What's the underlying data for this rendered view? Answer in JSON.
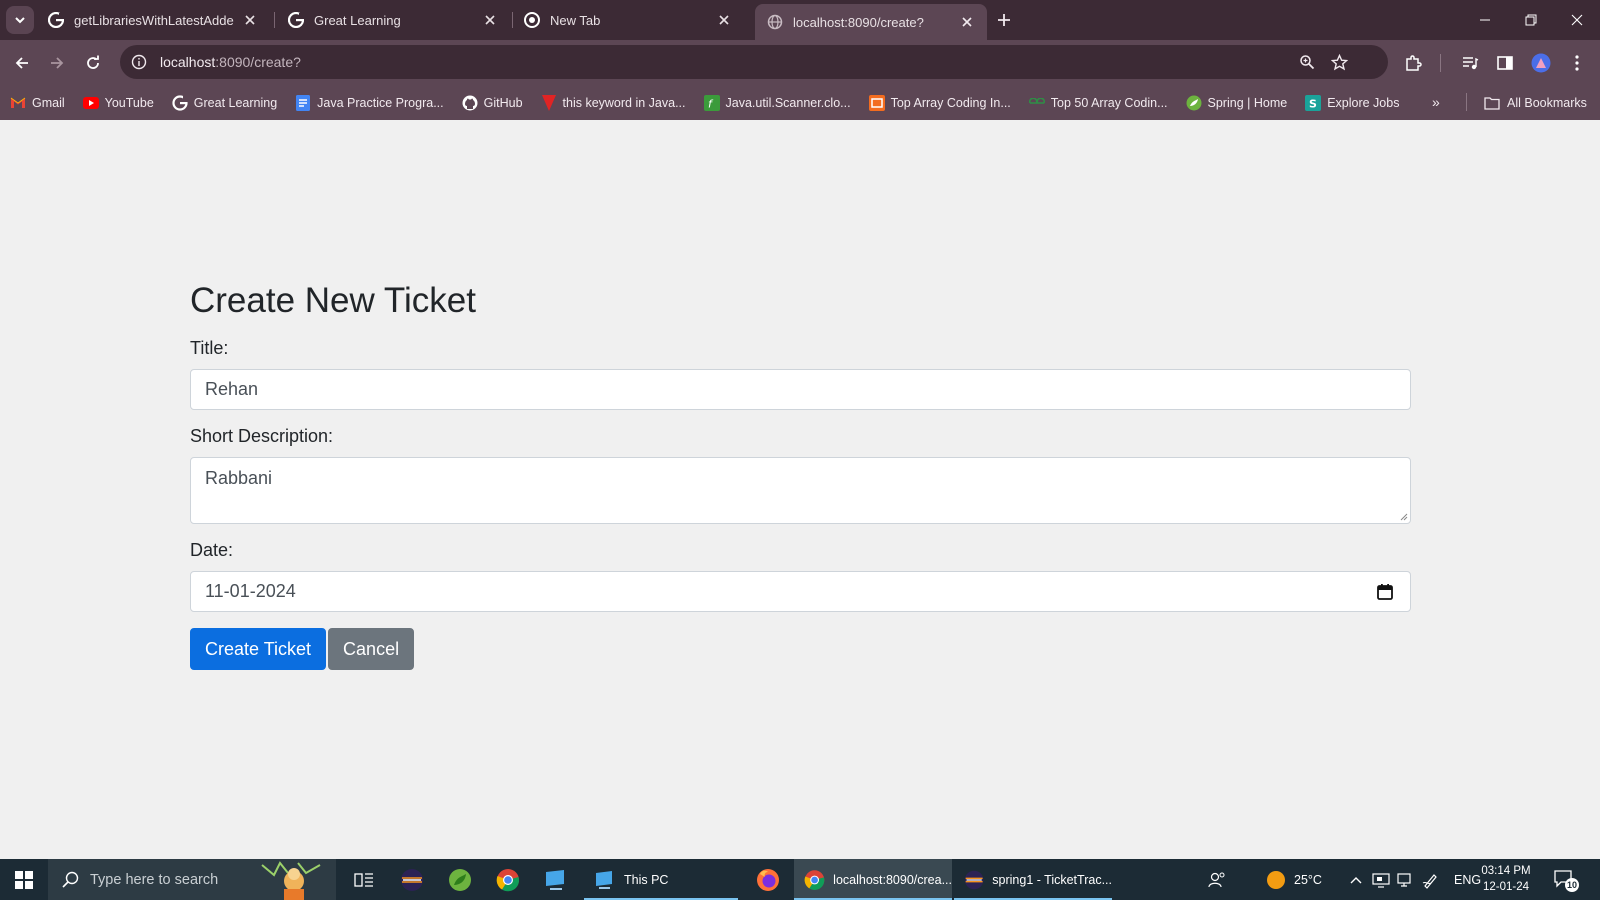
{
  "browser": {
    "tabs": [
      {
        "title": "getLibrariesWithLatestAddedOr",
        "icon": "google-g-icon",
        "active": false
      },
      {
        "title": "Great Learning",
        "icon": "google-g-icon",
        "active": false
      },
      {
        "title": "New Tab",
        "icon": "chrome-icon",
        "active": false
      },
      {
        "title": "localhost:8090/create?",
        "icon": "globe-icon",
        "active": true
      }
    ],
    "address": {
      "host": "localhost",
      "path": ":8090/create?"
    },
    "bookmarks": [
      {
        "label": "Gmail",
        "icon": "gmail-icon"
      },
      {
        "label": "YouTube",
        "icon": "youtube-icon"
      },
      {
        "label": "Great Learning",
        "icon": "google-g-icon"
      },
      {
        "label": "Java Practice Progra...",
        "icon": "docs-icon"
      },
      {
        "label": "GitHub",
        "icon": "github-icon"
      },
      {
        "label": "this keyword in Java...",
        "icon": "bookmark-red-icon"
      },
      {
        "label": "Java.util.Scanner.clo...",
        "icon": "scanner-site-icon"
      },
      {
        "label": "Top Array Coding In...",
        "icon": "coding-site-icon"
      },
      {
        "label": "Top 50 Array Codin...",
        "icon": "gfg-icon"
      },
      {
        "label": "Spring | Home",
        "icon": "spring-icon"
      },
      {
        "label": "Explore Jobs",
        "icon": "jobs-site-icon"
      }
    ],
    "all_bookmarks_label": "All Bookmarks",
    "more_bookmarks_label": "»"
  },
  "form": {
    "heading": "Create New Ticket",
    "title_label": "Title:",
    "title_value": "Rehan",
    "description_label": "Short Description:",
    "description_value": "Rabbani",
    "date_label": "Date:",
    "date_value": "11-01-2024",
    "submit_label": "Create Ticket",
    "cancel_label": "Cancel"
  },
  "taskbar": {
    "search_placeholder": "Type here to search",
    "apps": [
      {
        "label": "",
        "icon": "task-view-icon"
      },
      {
        "label": "",
        "icon": "eclipse-icon"
      },
      {
        "label": "",
        "icon": "spring-tools-icon"
      },
      {
        "label": "",
        "icon": "chrome-icon"
      },
      {
        "label": "",
        "icon": "pc-icon"
      },
      {
        "label": "This PC",
        "icon": "file-explorer-icon"
      },
      {
        "label": "",
        "icon": "firefox-icon"
      },
      {
        "label": "localhost:8090/crea...",
        "icon": "chrome-icon"
      },
      {
        "label": "spring1 - TicketTrac...",
        "icon": "eclipse-icon"
      }
    ],
    "weather": "25°C",
    "language": "ENG",
    "time": "03:14 PM",
    "date": "12-01-24",
    "notification_count": "10"
  },
  "colors": {
    "tab_strip": "#3c2a35",
    "toolbar": "#5c4654",
    "page_bg": "#f0f0f0",
    "primary_button": "#0b6ee0",
    "secondary_button": "#6c757d",
    "taskbar": "#1c2b35"
  }
}
